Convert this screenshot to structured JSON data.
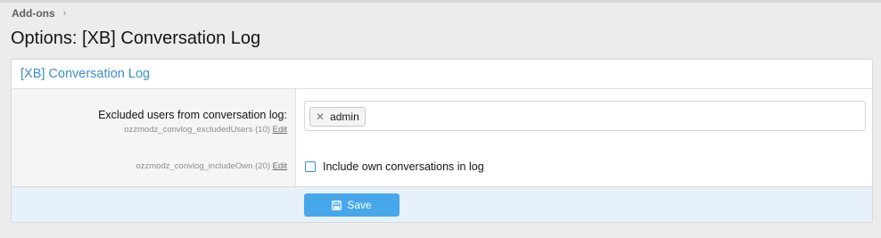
{
  "breadcrumb": {
    "items": [
      "Add-ons"
    ]
  },
  "page": {
    "title": "Options: [XB] Conversation Log"
  },
  "panel": {
    "header": "[XB] Conversation Log",
    "rows": [
      {
        "label": "Excluded users from conversation log:",
        "hint": "ozzmodz_convlog_excludedUsers (10)",
        "edit": "Edit",
        "tokens": [
          "admin"
        ]
      },
      {
        "hint": "ozzmodz_convlog_includeOwn (20)",
        "edit": "Edit",
        "checkbox_label": "Include own conversations in log",
        "checked": false
      }
    ]
  },
  "footer": {
    "save_label": "Save"
  },
  "colors": {
    "accent": "#3a8fcc",
    "button": "#47a7eb",
    "footer_bg": "#e6f1fb"
  },
  "icons": {
    "breadcrumb_separator": "chevron-right-icon",
    "save": "floppy-disk-icon",
    "token_remove": "close-icon"
  }
}
